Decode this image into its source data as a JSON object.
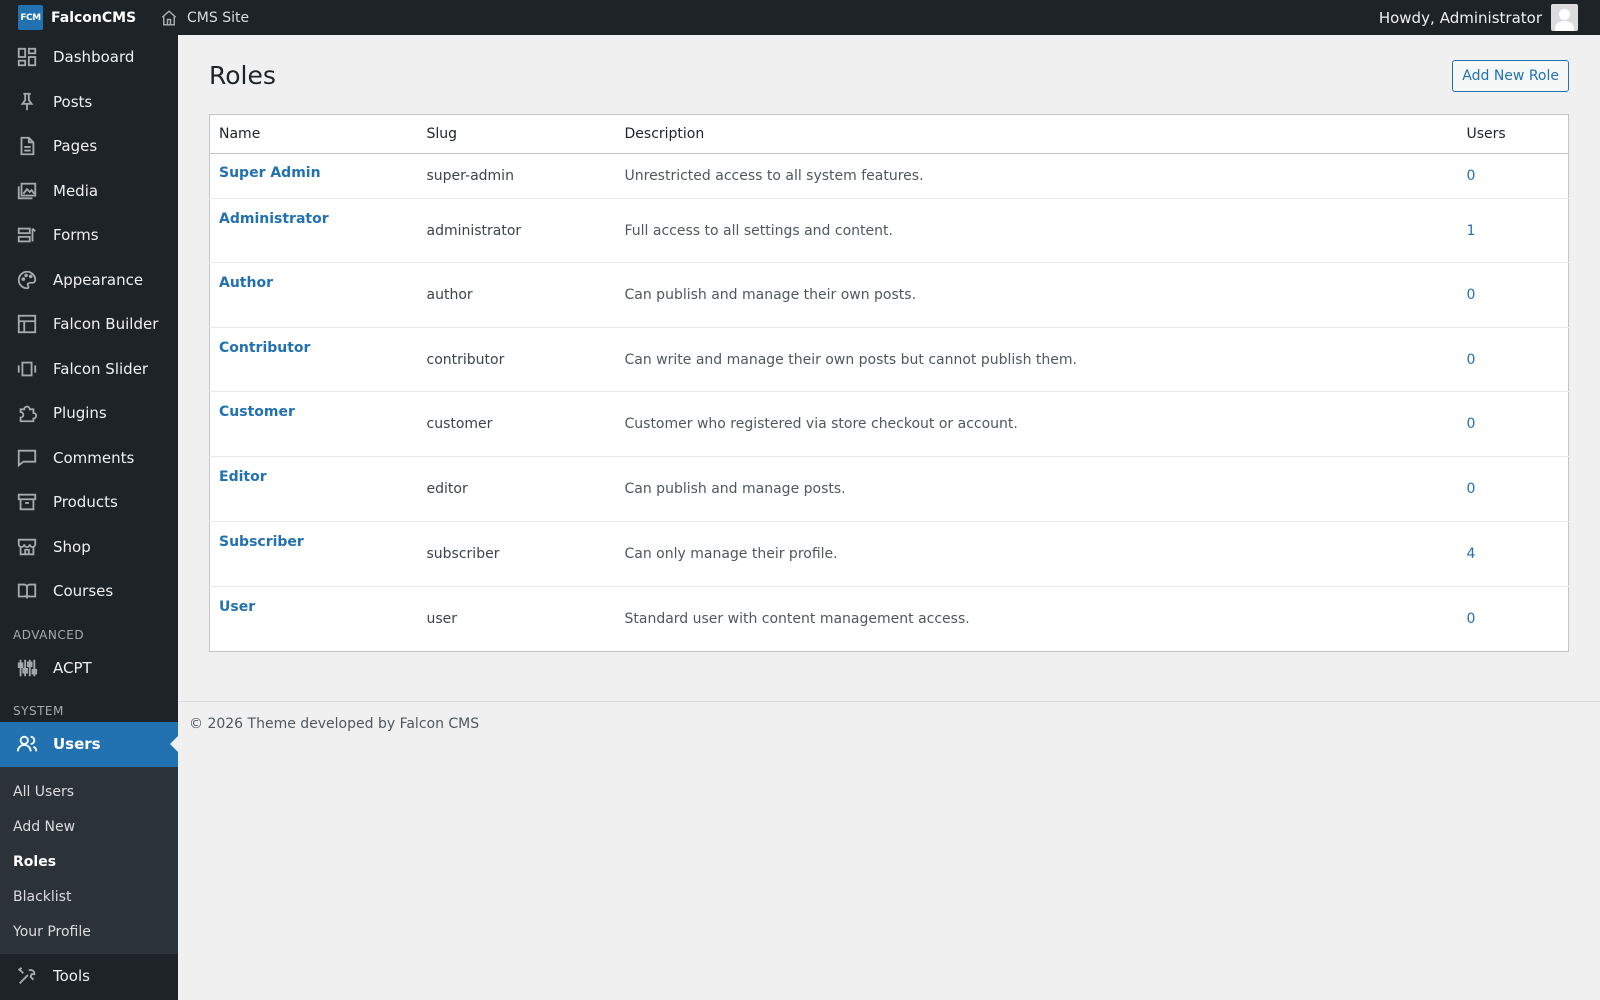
{
  "topbar": {
    "logo_text": "FCM",
    "brand": "FalconCMS",
    "site_link": "CMS Site",
    "howdy": "Howdy,",
    "user": "Administrator"
  },
  "sidebar": {
    "items": [
      {
        "label": "Dashboard",
        "icon": "dashboard-icon"
      },
      {
        "label": "Posts",
        "icon": "pin-icon"
      },
      {
        "label": "Pages",
        "icon": "page-icon"
      },
      {
        "label": "Media",
        "icon": "media-icon"
      },
      {
        "label": "Forms",
        "icon": "forms-icon"
      },
      {
        "label": "Appearance",
        "icon": "palette-icon"
      },
      {
        "label": "Falcon Builder",
        "icon": "layout-icon"
      },
      {
        "label": "Falcon Slider",
        "icon": "slider-icon"
      },
      {
        "label": "Plugins",
        "icon": "plugin-icon"
      },
      {
        "label": "Comments",
        "icon": "comment-icon"
      },
      {
        "label": "Products",
        "icon": "archive-icon"
      },
      {
        "label": "Shop",
        "icon": "store-icon"
      },
      {
        "label": "Courses",
        "icon": "book-icon"
      }
    ],
    "section_advanced": "ADVANCED",
    "acpt": "ACPT",
    "section_system": "SYSTEM",
    "users": "Users",
    "submenu": [
      "All Users",
      "Add New",
      "Roles",
      "Blacklist",
      "Your Profile"
    ],
    "tools": "Tools"
  },
  "main": {
    "title": "Roles",
    "add_button": "Add New Role",
    "columns": [
      "Name",
      "Slug",
      "Description",
      "Users"
    ],
    "rows": [
      {
        "name": "Super Admin",
        "slug": "super-admin",
        "description": "Unrestricted access to all system features.",
        "users": "0"
      },
      {
        "name": "Administrator",
        "slug": "administrator",
        "description": "Full access to all settings and content.",
        "users": "1"
      },
      {
        "name": "Author",
        "slug": "author",
        "description": "Can publish and manage their own posts.",
        "users": "0"
      },
      {
        "name": "Contributor",
        "slug": "contributor",
        "description": "Can write and manage their own posts but cannot publish them.",
        "users": "0"
      },
      {
        "name": "Customer",
        "slug": "customer",
        "description": "Customer who registered via store checkout or account.",
        "users": "0"
      },
      {
        "name": "Editor",
        "slug": "editor",
        "description": "Can publish and manage posts.",
        "users": "0"
      },
      {
        "name": "Subscriber",
        "slug": "subscriber",
        "description": "Can only manage their profile.",
        "users": "4"
      },
      {
        "name": "User",
        "slug": "user",
        "description": "Standard user with content management access.",
        "users": "0"
      }
    ]
  },
  "footer": {
    "text": "© 2026 Theme developed by Falcon CMS"
  },
  "colors": {
    "accent": "#2271b1",
    "sidebar_bg": "#1d2327",
    "submenu_bg": "#2c3338",
    "page_bg": "#f0f0f1"
  }
}
